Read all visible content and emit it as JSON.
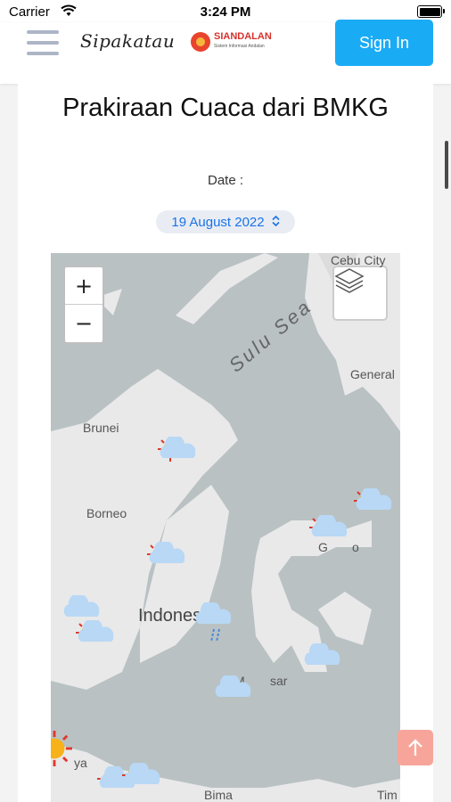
{
  "status_bar": {
    "carrier": "Carrier",
    "time": "3:24 PM"
  },
  "header": {
    "logo_text": "Sipakatau",
    "partner_logo_text": "SIANDALAN",
    "partner_logo_subtitle": "Sistem Informasi Andalan",
    "signin_label": "Sign In"
  },
  "main": {
    "title": "Prakiraan Cuaca dari BMKG",
    "date_label": "Date :",
    "date_value": "19 August 2022"
  },
  "map": {
    "zoom_in": "+",
    "zoom_out": "−",
    "labels": {
      "cebu": "Cebu City",
      "sulu_sea": "Sulu Sea",
      "general": "General",
      "brunei": "Brunei",
      "borneo": "Borneo",
      "indonesia": "Indonesi",
      "makassar_a": "M",
      "makassar_b": "sar",
      "gorontalo_a": "G",
      "gorontalo_b": "o",
      "surabaya": "ya",
      "bima": "Bima",
      "timor": "Tim"
    },
    "icons": [
      "zoom-in-icon",
      "zoom-out-icon",
      "layers-icon",
      "weather-partly-cloudy-icon",
      "weather-cloudy-icon",
      "weather-rain-icon",
      "weather-sunny-icon"
    ]
  },
  "colors": {
    "accent": "#1aabf5",
    "map_sea": "#b9c1c3",
    "map_land": "#ebebeb",
    "sun": "#f7b21a",
    "cloud": "#b8d8f5",
    "scroll_top": "#f7a59a"
  }
}
